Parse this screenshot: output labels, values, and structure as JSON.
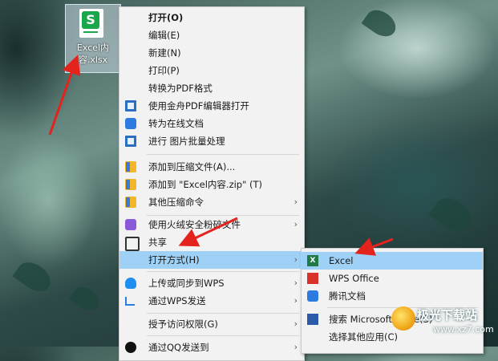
{
  "desktop_file": {
    "name": "Excel内容.xlsx",
    "glyph": "S"
  },
  "context_menu": {
    "items": [
      {
        "label": "打开(O)",
        "icon": "",
        "bold": true
      },
      {
        "label": "编辑(E)",
        "icon": ""
      },
      {
        "label": "新建(N)",
        "icon": ""
      },
      {
        "label": "打印(P)",
        "icon": ""
      },
      {
        "label": "转换为PDF格式",
        "icon": ""
      },
      {
        "label": "使用金舟PDF编辑器打开",
        "icon": "pdf-editor-icon"
      },
      {
        "label": "转为在线文档",
        "icon": "tencent-docs-icon"
      },
      {
        "label": "进行 图片批量处理",
        "icon": "image-batch-icon"
      },
      {
        "label": "添加到压缩文件(A)...",
        "icon": "archive-icon"
      },
      {
        "label": "添加到 \"Excel内容.zip\" (T)",
        "icon": "archive-icon"
      },
      {
        "label": "其他压缩命令",
        "icon": "archive-icon",
        "submenu": true
      },
      {
        "label": "使用火绒安全粉碎文件",
        "icon": "shredder-icon",
        "submenu": true
      },
      {
        "label": "共享",
        "icon": "share-icon"
      },
      {
        "label": "打开方式(H)",
        "icon": "",
        "submenu": true,
        "highlighted": true
      },
      {
        "label": "上传或同步到WPS",
        "icon": "cloud-icon",
        "submenu": true
      },
      {
        "label": "通过WPS发送",
        "icon": "send-icon",
        "submenu": true
      },
      {
        "label": "授予访问权限(G)",
        "icon": "",
        "submenu": true
      },
      {
        "label": "通过QQ发送到",
        "icon": "qq-icon",
        "submenu": true
      }
    ],
    "arrow_glyph": "›"
  },
  "open_with_submenu": {
    "items": [
      {
        "label": "Excel",
        "icon": "excel-icon",
        "highlighted": true
      },
      {
        "label": "WPS Office",
        "icon": "wps-icon"
      },
      {
        "label": "腾讯文档",
        "icon": "tencent-docs-icon"
      },
      {
        "label": "搜索 Microsoft Store(S)",
        "icon": "store-icon"
      },
      {
        "label": "选择其他应用(C)",
        "icon": ""
      }
    ]
  },
  "watermark": {
    "title": "极光下载站",
    "url": "www.xz7.com"
  },
  "colors": {
    "highlight": "#9fd0f5",
    "menu_bg": "#f2f2f2",
    "arrow_red": "#e3231c",
    "excel_green": "#1f7a45"
  }
}
